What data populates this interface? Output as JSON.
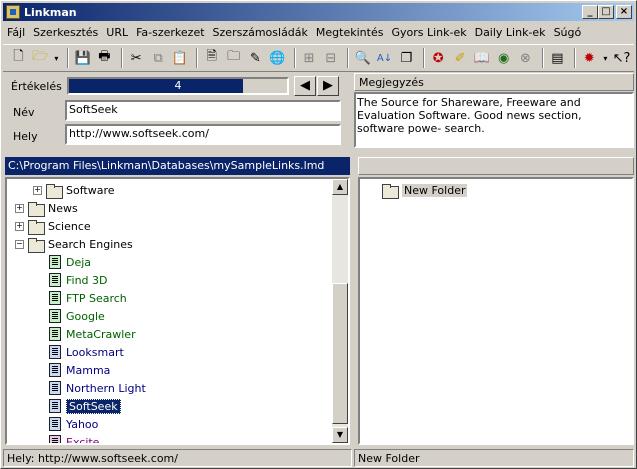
{
  "window": {
    "title": "Linkman"
  },
  "menu": [
    "Fájl",
    "Szerkesztés",
    "URL",
    "Fa-szerkezet",
    "Szerszámosládák",
    "Megtekintés",
    "Gyors Link-ek",
    "Daily Link-ek",
    "Súgó"
  ],
  "fields": {
    "rating_label": "Értékelés",
    "rating_value": "4",
    "rating_fraction": 0.8,
    "name_label": "Név",
    "name_value": "SoftSeek",
    "location_label": "Hely",
    "location_value": "http://www.softseek.com/",
    "notes_label": "Megjegyzés",
    "notes_value": "The Source for Shareware, Freeware and Evaluation Software. Good news section, software powe- search."
  },
  "path": "C:\\Program Files\\Linkman\\Databases\\mySampleLinks.lmd",
  "tree": [
    {
      "label": "Software",
      "kind": "folder",
      "expander": "+"
    },
    {
      "label": "News",
      "kind": "folder",
      "expander": "+"
    },
    {
      "label": "Science",
      "kind": "folder",
      "expander": "+"
    },
    {
      "label": "Search Engines",
      "kind": "folder-open",
      "expander": "-"
    },
    {
      "label": "Deja",
      "kind": "link",
      "color": "green"
    },
    {
      "label": "Find 3D",
      "kind": "link",
      "color": "green"
    },
    {
      "label": "FTP Search",
      "kind": "link",
      "color": "green"
    },
    {
      "label": "Google",
      "kind": "link",
      "color": "green"
    },
    {
      "label": "MetaCrawler",
      "kind": "link",
      "color": "green"
    },
    {
      "label": "Looksmart",
      "kind": "link",
      "color": "blue"
    },
    {
      "label": "Mamma",
      "kind": "link",
      "color": "blue"
    },
    {
      "label": "Northern Light",
      "kind": "link",
      "color": "blue"
    },
    {
      "label": "SoftSeek",
      "kind": "link",
      "color": "blue",
      "selected": true
    },
    {
      "label": "Yahoo",
      "kind": "link",
      "color": "blue"
    },
    {
      "label": "Excite",
      "kind": "link",
      "color": "purple"
    }
  ],
  "right_tree": {
    "label": "New Folder"
  },
  "status": {
    "left": "Hely: http://www.softseek.com/",
    "right": "New Folder"
  }
}
